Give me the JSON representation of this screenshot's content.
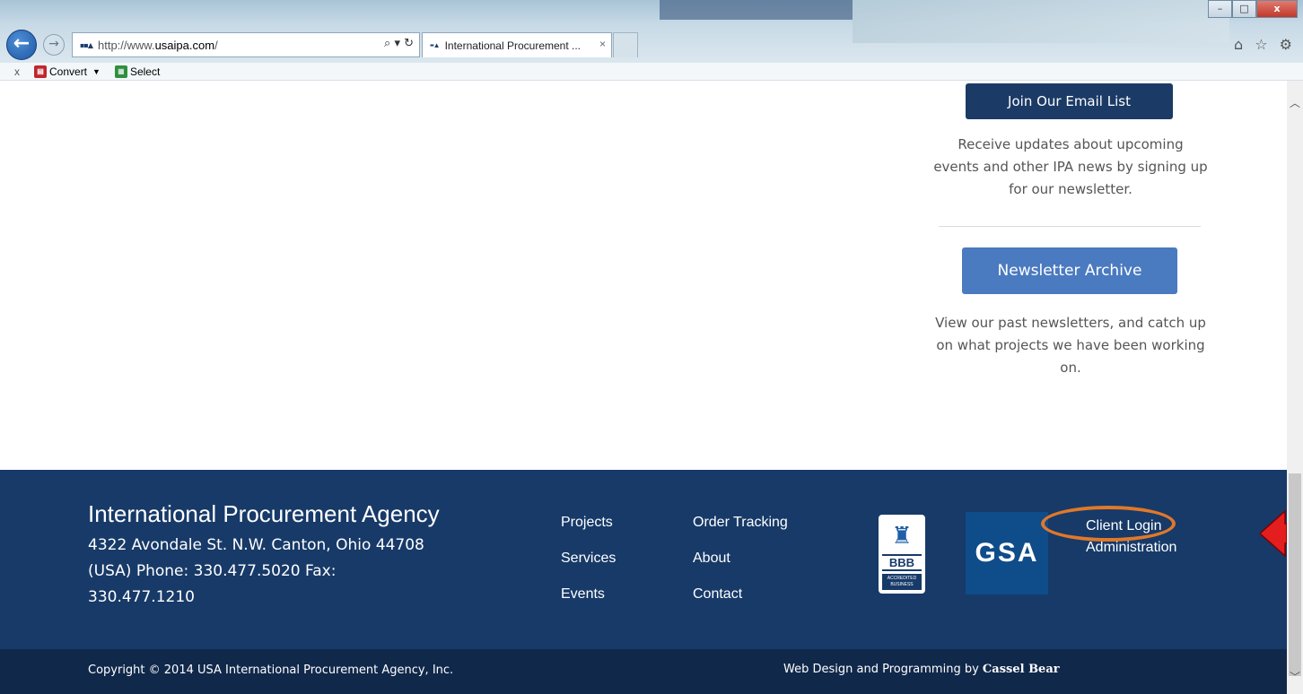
{
  "browser": {
    "url_prefix": "http://www.",
    "url_host": "usaipa.com",
    "url_suffix": "/",
    "tab_title": "International Procurement ...",
    "tab_close": "×",
    "address_icons": "⌕ ▾ ↻",
    "window_controls": [
      "–",
      "□",
      "x"
    ],
    "right_icons": "⌂ ☆ ⚙"
  },
  "command_bar": {
    "close": "x",
    "convert_label": "Convert",
    "select_label": "Select"
  },
  "sidebar": {
    "email_button": "Join Our Email List",
    "email_text": "Receive updates about upcoming events and other IPA news by signing up for our newsletter.",
    "archive_button": "Newsletter Archive",
    "archive_text": "View our past newsletters, and catch up on what projects we have been working on."
  },
  "footer": {
    "org_name": "International Procurement Agency",
    "org_address": "4322 Avondale St. N.W. Canton, Ohio 44708 (USA) Phone: 330.477.5020 Fax: 330.477.1210",
    "nav_col_1": [
      "Projects",
      "Services",
      "Events"
    ],
    "nav_col_2": [
      "Order Tracking",
      "About",
      "Contact"
    ],
    "bbb_text": "BBB",
    "bbb_sub": "ACCREDITED BUSINESS",
    "gsa_text": "GSA",
    "client_login": "Client Login",
    "administration": "Administration",
    "copyright": "Copyright © 2014 USA International Procurement Agency, Inc.",
    "credits_prefix": "Web Design and Programming by ",
    "credits_name": "Cassel Bear"
  },
  "colors": {
    "footer_bg": "#173a68",
    "footer_bottom_bg": "#10284a",
    "email_button_bg": "#1b3b66",
    "archive_button_bg": "#4a7ac0",
    "highlight_ellipse": "#e0782a",
    "arrow": "#e41e1e"
  }
}
